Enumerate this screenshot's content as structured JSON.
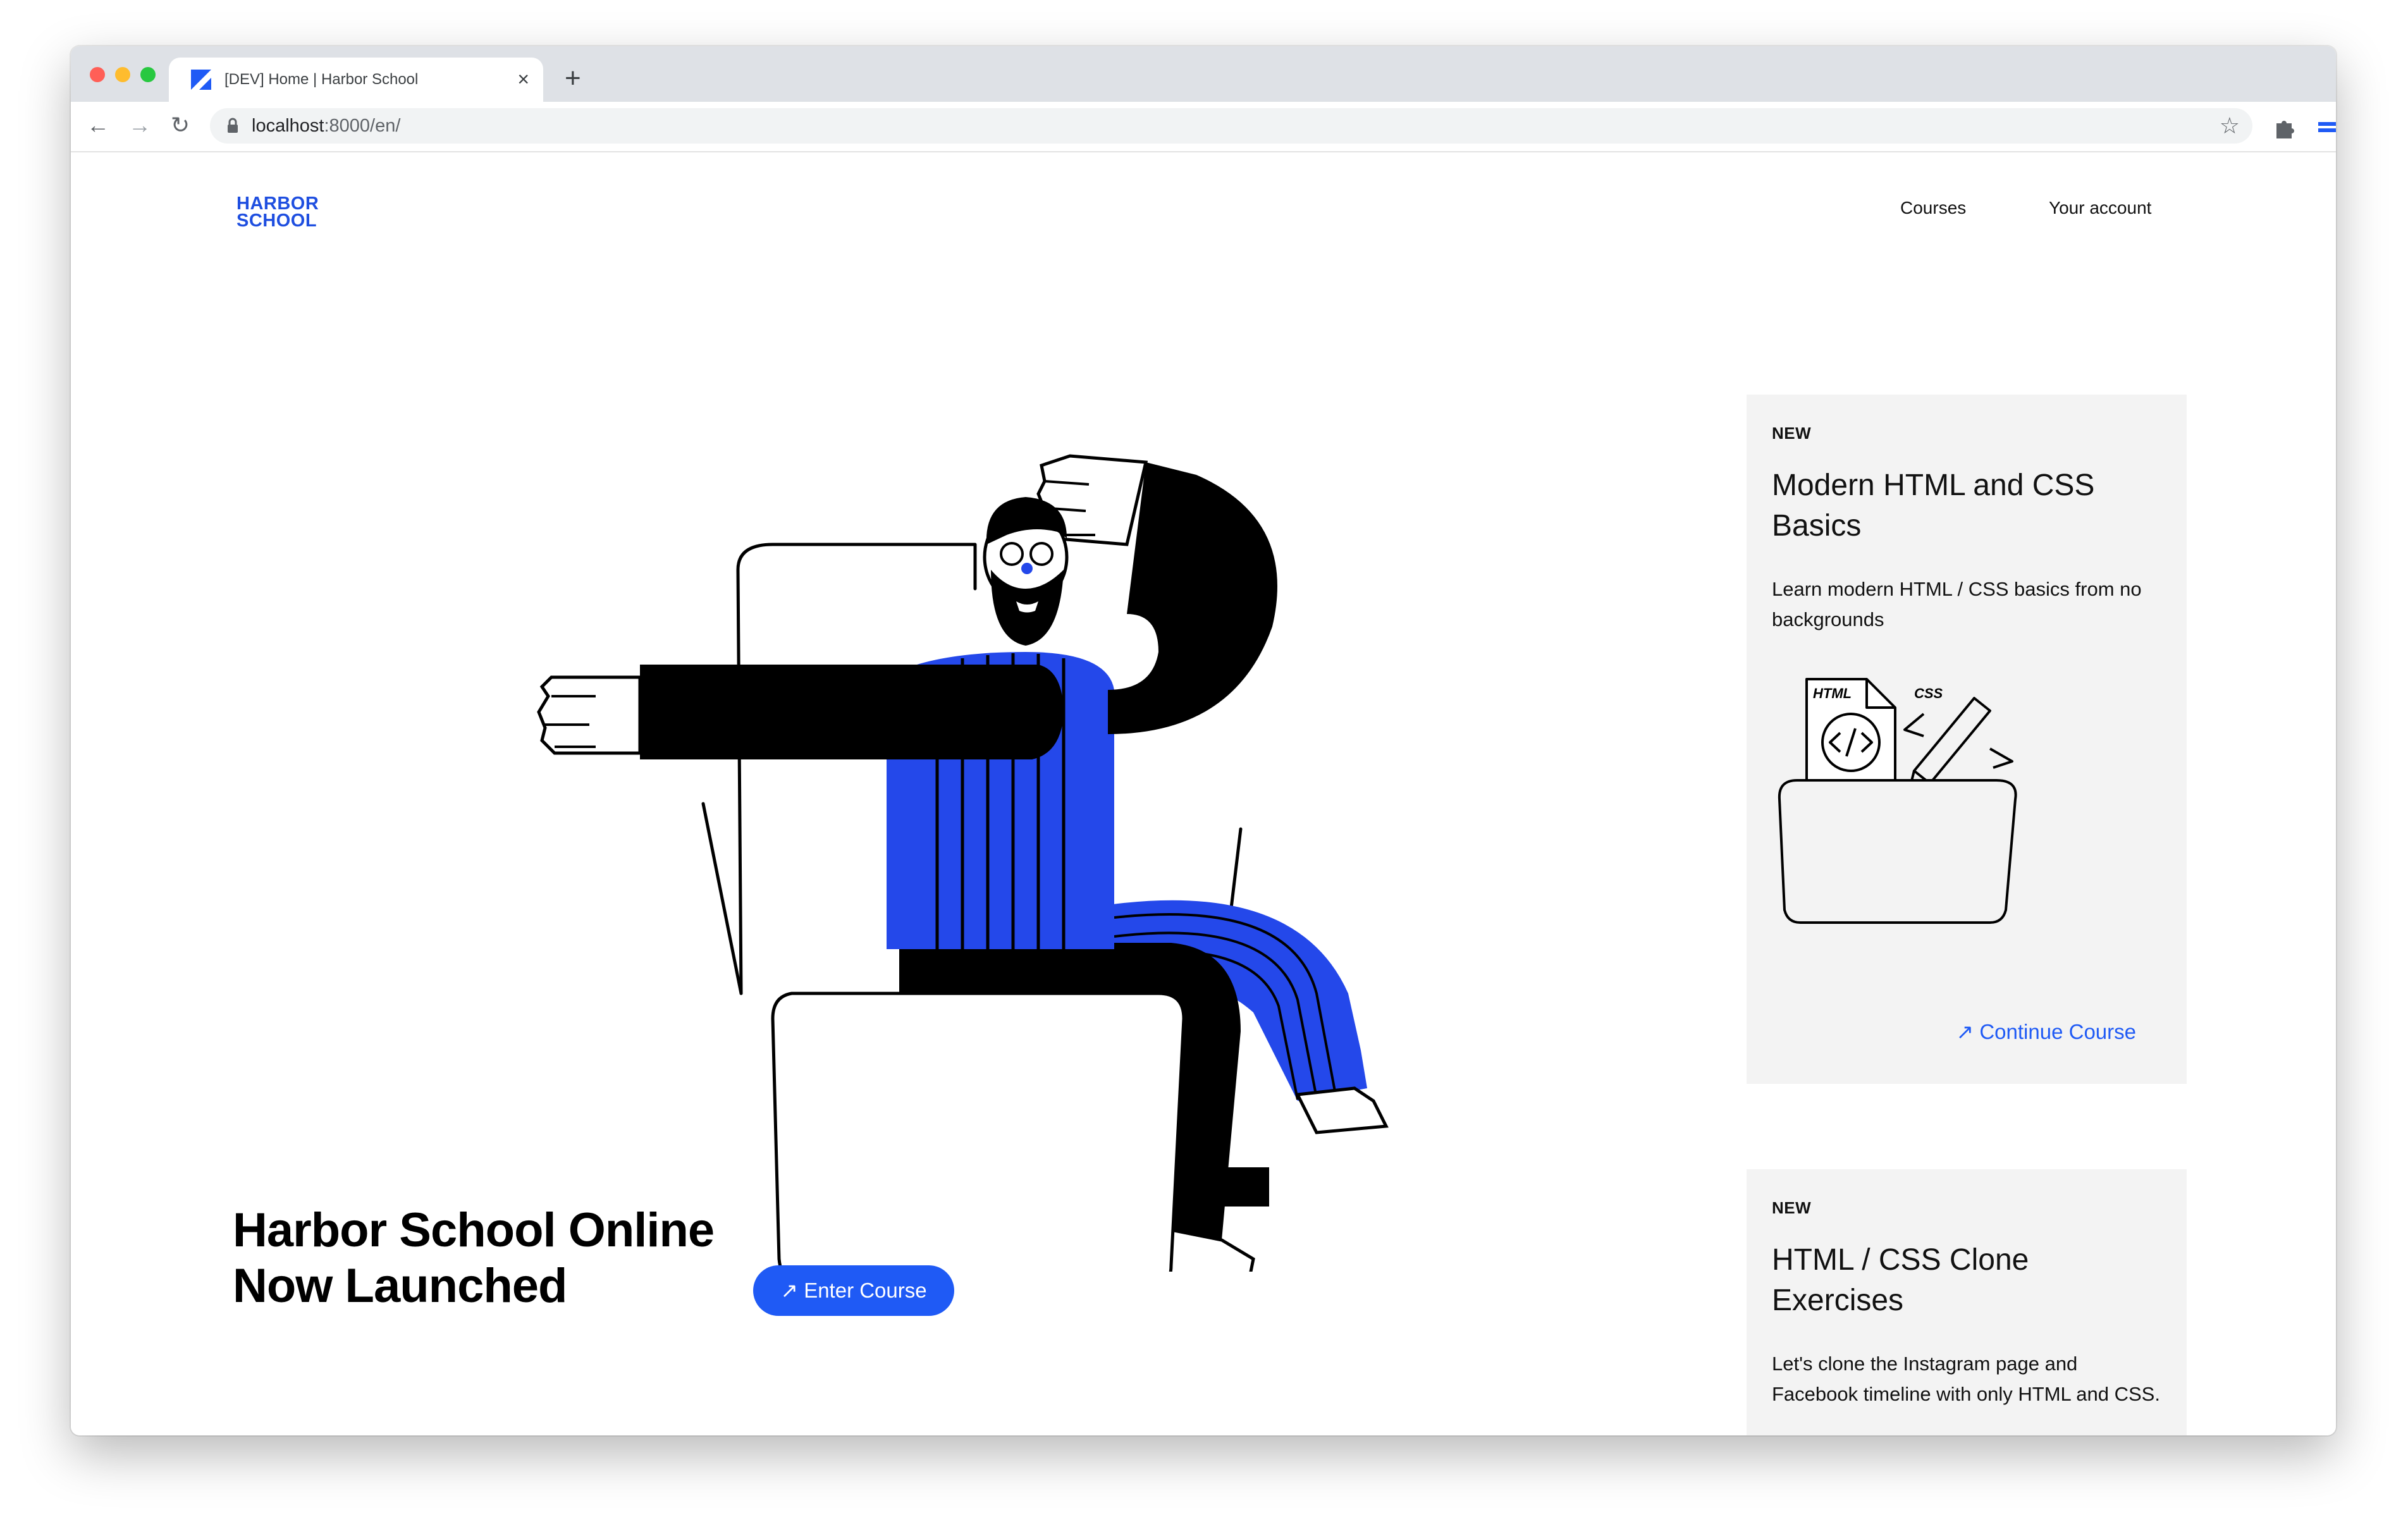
{
  "browser": {
    "tab_title": "[DEV] Home | Harbor School",
    "tab_close": "×",
    "new_tab": "+",
    "url_host": "localhost",
    "url_rest": ":8000/en/",
    "back_icon": "←",
    "forward_icon": "→",
    "reload_icon": "↻",
    "star_icon": "☆",
    "menu_icon": "⋮",
    "traffic_colors": [
      "#ff5f57",
      "#febc2e",
      "#28c840"
    ]
  },
  "site": {
    "logo_line1": "HARBOR",
    "logo_line2": "SCHOOL",
    "nav": [
      "Courses",
      "Your account"
    ],
    "brand_color": "#1f5af5"
  },
  "hero": {
    "title_line1": "Harbor School Online",
    "title_line2": "Now Launched",
    "cta_icon": "↗",
    "cta_label": "Enter Course"
  },
  "cards": [
    {
      "badge": "NEW",
      "title": "Modern HTML and CSS Basics",
      "description": "Learn modern HTML / CSS basics from no backgrounds",
      "illustration_html_label": "HTML",
      "illustration_css_label": "CSS",
      "link_icon": "↗",
      "link_label": "Continue Course"
    },
    {
      "badge": "NEW",
      "title": "HTML / CSS Clone Exercises",
      "description": "Let's clone the Instagram page and Facebook timeline with only HTML and CSS."
    }
  ]
}
